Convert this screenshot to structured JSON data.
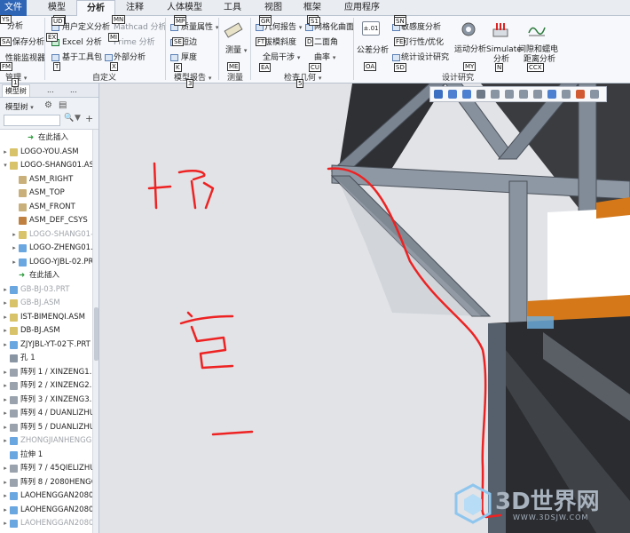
{
  "tabs": [
    {
      "label": "文件",
      "kt": ""
    },
    {
      "label": "模型",
      "kt": "UA"
    },
    {
      "label": "分析",
      "kt": ""
    },
    {
      "label": "注释",
      "kt": "MN"
    },
    {
      "label": "人体模型",
      "kt": "MP"
    },
    {
      "label": "工具",
      "kt": "GR"
    },
    {
      "label": "视图",
      "kt": "S1"
    },
    {
      "label": "框架",
      "kt": ""
    },
    {
      "label": "应用程序",
      "kt": "SN"
    }
  ],
  "file_kt": "YS",
  "ribbon": {
    "manage": {
      "items": [
        "分析",
        "保存分析",
        "性能监视器"
      ],
      "kts": [
        "SA",
        "FM"
      ],
      "label": "管理",
      "group_kt": "1"
    },
    "custom": {
      "items": [
        "用户定义分析",
        "Excel 分析",
        "基于工具包",
        "Mathcad 分析",
        "Prime 分析",
        "外部分析"
      ],
      "kts": [
        "UD",
        "EX",
        "T",
        "MN",
        "MI",
        "X"
      ],
      "label": "自定义"
    },
    "model_report": {
      "items": [
        "质量属性",
        "短边",
        "厚度"
      ],
      "kts": [
        "MP",
        "SE",
        "K"
      ],
      "label": "模型报告",
      "group_kt": "3"
    },
    "measure": {
      "item": "测量",
      "label": "测量",
      "kt": "ME"
    },
    "check_geometry": {
      "items": [
        "几何报告",
        "网格化曲面",
        "拔模斜度",
        "二面角",
        "全局干涉",
        "曲率"
      ],
      "kts": [
        "GR",
        "S1",
        "FT",
        "D",
        "EA",
        "CU"
      ],
      "label": "检查几何",
      "group_kt": "5"
    },
    "design_study": {
      "items": [
        "公差分析",
        "敏感度分析",
        "可行性/优化",
        "统计设计研究",
        "运动分析",
        "Simulate 分析",
        "间隙和蠕电距离分析"
      ],
      "short": {
        "tol": "公差分析",
        "motion": "运动分析",
        "sim1": "Simulate",
        "sim2": "分析",
        "clr1": "间隙和蠕电",
        "clr2": "距离分析"
      },
      "kts": [
        "SN",
        "FE",
        "SD",
        "OA",
        "MY",
        "N",
        "CCX"
      ],
      "label": "设计研究"
    }
  },
  "panel": {
    "tabs": [
      "模型树",
      "...",
      "..."
    ],
    "toolbar_label": "模型树",
    "rows": [
      {
        "label": "在此插入",
        "type": "insert",
        "indent": 2,
        "dim": false
      },
      {
        "label": "LOGO-YOU.ASM",
        "type": "asm",
        "indent": 0,
        "dim": false
      },
      {
        "label": "LOGO-SHANG01.ASM",
        "type": "asm",
        "indent": 0,
        "dim": false,
        "open": true
      },
      {
        "label": "ASM_RIGHT",
        "type": "plane",
        "indent": 1,
        "dim": false
      },
      {
        "label": "ASM_TOP",
        "type": "plane",
        "indent": 1,
        "dim": false
      },
      {
        "label": "ASM_FRONT",
        "type": "plane",
        "indent": 1,
        "dim": false
      },
      {
        "label": "ASM_DEF_CSYS",
        "type": "csys",
        "indent": 1,
        "dim": false
      },
      {
        "label": "LOGO-SHANG01-...",
        "type": "asm",
        "indent": 1,
        "dim": true
      },
      {
        "label": "LOGO-ZHENG01.A...",
        "type": "part",
        "indent": 1,
        "dim": false
      },
      {
        "label": "LOGO-YJBL-02.PRT",
        "type": "part",
        "indent": 1,
        "dim": false
      },
      {
        "label": "在此插入",
        "type": "insert",
        "indent": 1,
        "dim": false
      },
      {
        "label": "GB-BJ-03.PRT",
        "type": "part",
        "indent": 0,
        "dim": true
      },
      {
        "label": "GB-BJ.ASM",
        "type": "asm",
        "indent": 0,
        "dim": true
      },
      {
        "label": "IST-BIMENQI.ASM",
        "type": "asm",
        "indent": 0,
        "dim": false
      },
      {
        "label": "DB-BJ.ASM",
        "type": "asm",
        "indent": 0,
        "dim": false
      },
      {
        "label": "ZJYJBL-YT-02下.PRT",
        "type": "part",
        "indent": 0,
        "dim": false
      },
      {
        "label": "孔 1",
        "type": "hole",
        "indent": 0,
        "dim": false
      },
      {
        "label": "阵列 1 / XINZENG1.PR...",
        "type": "pattern",
        "indent": 0,
        "dim": false
      },
      {
        "label": "阵列 2 / XINZENG2.PR...",
        "type": "pattern",
        "indent": 0,
        "dim": false
      },
      {
        "label": "阵列 3 / XINZENG3.PR...",
        "type": "pattern",
        "indent": 0,
        "dim": false
      },
      {
        "label": "阵列 4 / DUANLIZHU...",
        "type": "pattern",
        "indent": 0,
        "dim": false
      },
      {
        "label": "阵列 5 / DUANLIZHU...",
        "type": "pattern",
        "indent": 0,
        "dim": false
      },
      {
        "label": "ZHONGJIANHENGG...",
        "type": "part",
        "indent": 0,
        "dim": true
      },
      {
        "label": "拉伸 1",
        "type": "extrude",
        "indent": 0,
        "dim": false
      },
      {
        "label": "阵列 7 / 45QIELIZHU...",
        "type": "pattern",
        "indent": 0,
        "dim": false
      },
      {
        "label": "阵列 8 / 2080HENGG...",
        "type": "pattern",
        "indent": 0,
        "dim": false
      },
      {
        "label": "LAOHENGGAN2080.P...",
        "type": "part",
        "indent": 0,
        "dim": false
      },
      {
        "label": "LAOHENGGAN2080.P...",
        "type": "part",
        "indent": 0,
        "dim": false
      },
      {
        "label": "LAOHENGGAN2080.P...",
        "type": "part",
        "indent": 0,
        "dim": true
      }
    ]
  },
  "annotation": {
    "text": "折弯一",
    "color": "#ee2222"
  },
  "watermark": {
    "brand": "3D世界网",
    "url": "WWW.3DSJW.COM"
  },
  "colors": {
    "file_tab": "#2f65b5",
    "frame_gray": "#6b7480",
    "frame_dark": "#2d2f33",
    "orange": "#d4781a",
    "annotation_red": "#ee2222"
  }
}
